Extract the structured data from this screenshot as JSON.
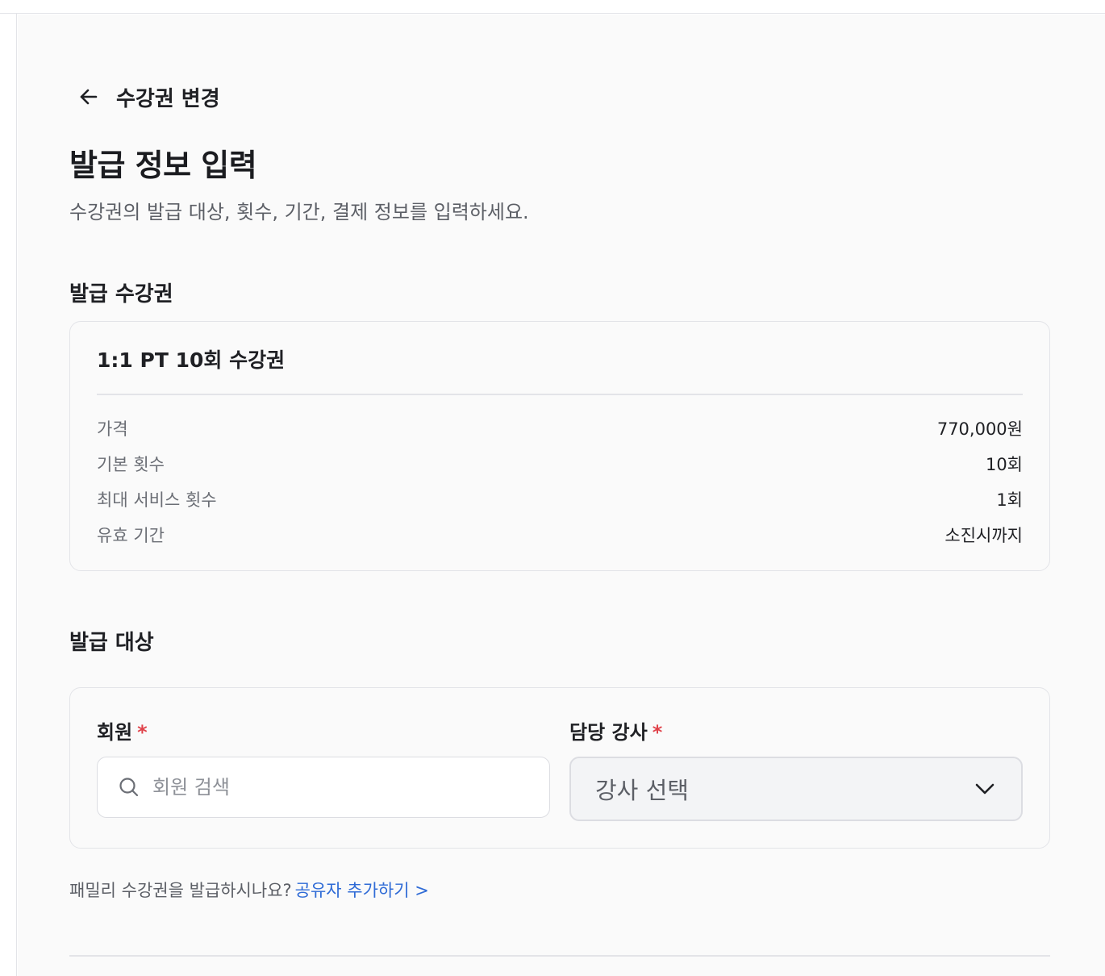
{
  "header": {
    "back_label": "수강권 변경",
    "title": "발급 정보 입력",
    "description": "수강권의 발급 대상, 횟수, 기간, 결제 정보를 입력하세요."
  },
  "pass_section": {
    "title": "발급 수강권",
    "pass_name": "1:1 PT 10회 수강권",
    "rows": [
      {
        "label": "가격",
        "value": "770,000원"
      },
      {
        "label": "기본 횟수",
        "value": "10회"
      },
      {
        "label": "최대 서비스 횟수",
        "value": "1회"
      },
      {
        "label": "유효 기간",
        "value": "소진시까지"
      }
    ]
  },
  "target_section": {
    "title": "발급 대상",
    "member_label": "회원",
    "member_placeholder": "회원 검색",
    "instructor_label": "담당 강사",
    "instructor_value": "강사 선택",
    "required_mark": "*"
  },
  "family": {
    "question": "패밀리 수강권을 발급하시나요?",
    "link": "공유자 추가하기 >"
  },
  "colors": {
    "required": "#e0424a",
    "link": "#2f6bd6"
  },
  "icons": {
    "back": "arrow-left-icon",
    "search": "search-icon",
    "dropdown": "chevron-down-icon"
  }
}
